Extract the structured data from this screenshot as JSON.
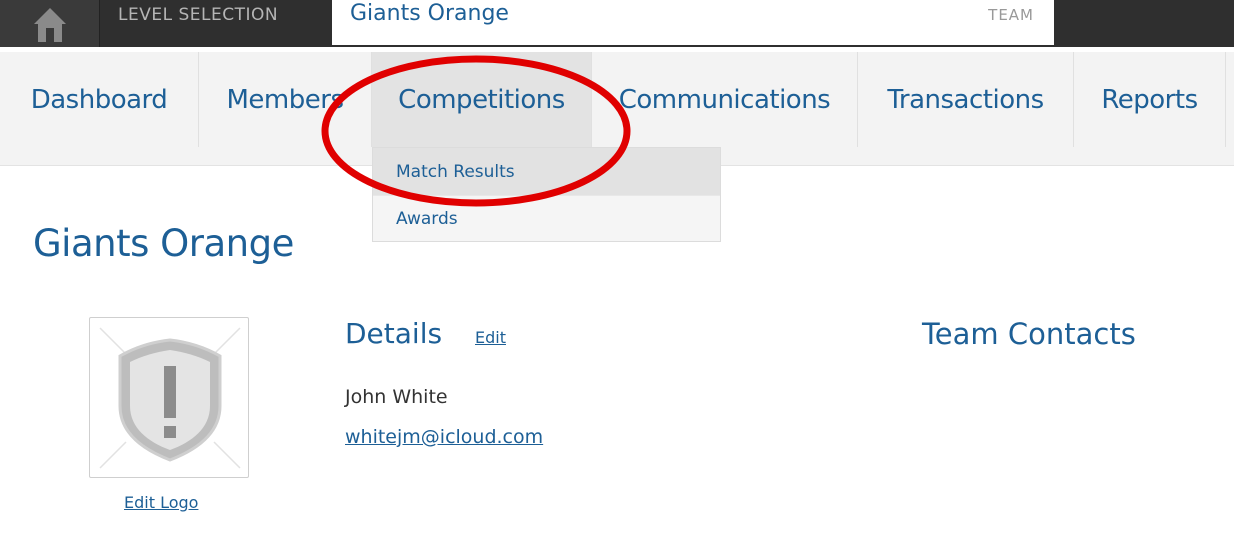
{
  "topbar": {
    "level_label": "LEVEL SELECTION",
    "selected_level": "Giants Orange",
    "level_type": "TEAM"
  },
  "nav": {
    "items": [
      {
        "label": "Dashboard"
      },
      {
        "label": "Members"
      },
      {
        "label": "Competitions"
      },
      {
        "label": "Communications"
      },
      {
        "label": "Transactions"
      },
      {
        "label": "Reports"
      }
    ],
    "active": "Competitions",
    "dropdown": [
      "Match Results",
      "Awards"
    ]
  },
  "page": {
    "title": "Giants Orange",
    "edit_logo": "Edit Logo",
    "details": {
      "heading": "Details",
      "edit_link": "Edit",
      "contact_name": "John White",
      "contact_email": "whitejm@icloud.com"
    },
    "team_contacts_heading": "Team Contacts"
  },
  "colors": {
    "link": "#1d5f96",
    "topbar": "#2f2f2f",
    "annotation": "#e00000"
  },
  "icons": {
    "home": "home-icon",
    "logo_placeholder": "shield-exclamation-icon"
  }
}
